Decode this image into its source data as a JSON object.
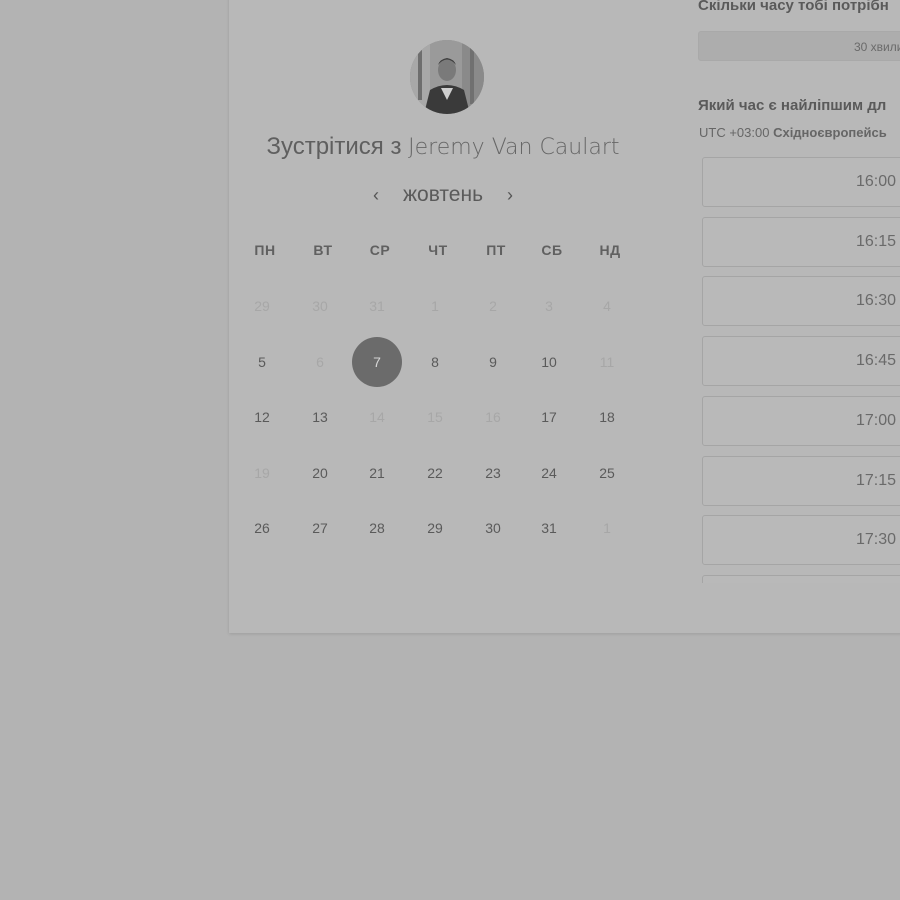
{
  "meeting": {
    "prefix": "Зустрітися з",
    "host_name": "Jeremy Van Caulart"
  },
  "calendar": {
    "month": "жовтень",
    "weekdays": [
      "ПН",
      "ВТ",
      "СР",
      "ЧТ",
      "ПТ",
      "СБ",
      "НД"
    ],
    "weeks": [
      [
        {
          "d": "29",
          "state": "muted"
        },
        {
          "d": "30",
          "state": "muted"
        },
        {
          "d": "31",
          "state": "muted"
        },
        {
          "d": "1",
          "state": "muted"
        },
        {
          "d": "2",
          "state": "muted"
        },
        {
          "d": "3",
          "state": "muted"
        },
        {
          "d": "4",
          "state": "muted"
        }
      ],
      [
        {
          "d": "5",
          "state": "available"
        },
        {
          "d": "6",
          "state": "muted"
        },
        {
          "d": "7",
          "state": "selected"
        },
        {
          "d": "8",
          "state": "available"
        },
        {
          "d": "9",
          "state": "available"
        },
        {
          "d": "10",
          "state": "available"
        },
        {
          "d": "11",
          "state": "muted"
        }
      ],
      [
        {
          "d": "12",
          "state": "available"
        },
        {
          "d": "13",
          "state": "available"
        },
        {
          "d": "14",
          "state": "muted"
        },
        {
          "d": "15",
          "state": "muted"
        },
        {
          "d": "16",
          "state": "muted"
        },
        {
          "d": "17",
          "state": "available"
        },
        {
          "d": "18",
          "state": "available"
        }
      ],
      [
        {
          "d": "19",
          "state": "muted"
        },
        {
          "d": "20",
          "state": "available"
        },
        {
          "d": "21",
          "state": "available"
        },
        {
          "d": "22",
          "state": "available"
        },
        {
          "d": "23",
          "state": "available"
        },
        {
          "d": "24",
          "state": "available"
        },
        {
          "d": "25",
          "state": "available"
        }
      ],
      [
        {
          "d": "26",
          "state": "available"
        },
        {
          "d": "27",
          "state": "available"
        },
        {
          "d": "28",
          "state": "available"
        },
        {
          "d": "29",
          "state": "available"
        },
        {
          "d": "30",
          "state": "available"
        },
        {
          "d": "31",
          "state": "available"
        },
        {
          "d": "1",
          "state": "muted"
        }
      ]
    ]
  },
  "booking": {
    "duration_question": "Скільки часу тобі потрібн",
    "duration_value": "30 хвили",
    "time_question": "Який час є найліпшим дл",
    "tz_offset": "UTC +03:00",
    "tz_name": "Східноєвропейсь",
    "slots": [
      "16:00",
      "16:15",
      "16:30",
      "16:45",
      "17:00",
      "17:15",
      "17:30",
      ""
    ]
  },
  "icons": {
    "prev": "chevron-left-icon",
    "next": "chevron-right-icon"
  },
  "colors": {
    "overlay_background": "#b3b3b3",
    "card_background": "#b8b8b8",
    "selected_day": "#6b6b6b"
  }
}
